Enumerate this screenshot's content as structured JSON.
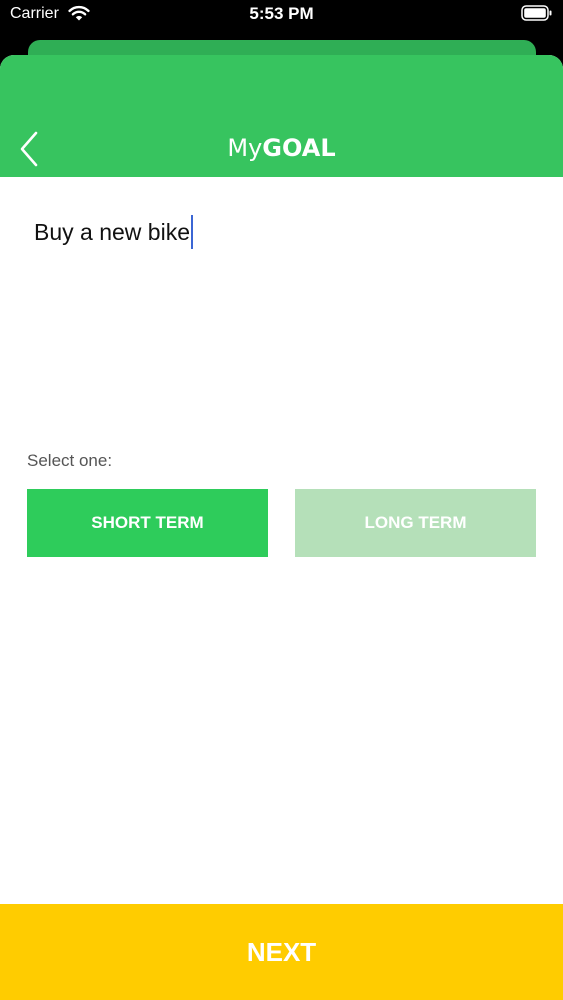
{
  "status_bar": {
    "carrier": "Carrier",
    "time": "5:53 PM",
    "wifi_icon": "wifi-icon",
    "battery_icon": "battery-icon"
  },
  "header": {
    "back_icon": "chevron-left-icon",
    "title_prefix": "My",
    "title_emphasis": "GOAL",
    "background_color": "#37c45f"
  },
  "goal_input": {
    "value": "Buy a new bike"
  },
  "term_selection": {
    "label": "Select one:",
    "options": [
      {
        "label": "SHORT TERM",
        "selected": true,
        "color": "#2ecc5b"
      },
      {
        "label": "LONG TERM",
        "selected": false,
        "color": "#b5e0b9"
      }
    ]
  },
  "footer": {
    "next_label": "NEXT",
    "color": "#ffcc00"
  }
}
